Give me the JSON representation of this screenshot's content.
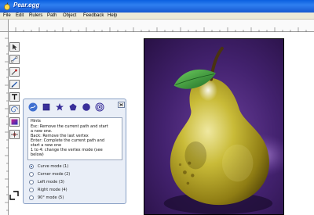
{
  "app": {
    "title": "Pear.egg"
  },
  "menu": {
    "items": [
      "File",
      "Edit",
      "Rulers",
      "Path",
      "Object",
      "Feedback",
      "Help"
    ]
  },
  "toolbar": {
    "tools": [
      {
        "icon": "select-arrow-icon"
      },
      {
        "icon": "node-edit-icon"
      },
      {
        "icon": "eyedropper-icon"
      },
      {
        "icon": "pen-icon"
      },
      {
        "icon": "text-icon"
      },
      {
        "icon": "spiral-icon"
      },
      {
        "icon": "gradient-icon"
      },
      {
        "icon": "crosshair-icon"
      }
    ]
  },
  "shape_palette": {
    "tools": [
      "freehand-path-icon",
      "rectangle-icon",
      "star-icon",
      "polygon-icon",
      "circle-icon",
      "spiral-shape-icon"
    ]
  },
  "help": {
    "title": "Hints",
    "lines": [
      "Esc: Remove the current path and start",
      "a new one.",
      "Back: Remove the last vertex",
      "Enter: Complete the current path and",
      "start a new one",
      "1 to 4: change the vertex mode (see",
      "below)"
    ]
  },
  "modes": [
    {
      "label": "Curve mode (1)",
      "checked": true
    },
    {
      "label": "Corner mode (2)",
      "checked": false
    },
    {
      "label": "Left mode (3)",
      "checked": false
    },
    {
      "label": "Right mode (4)",
      "checked": false
    },
    {
      "label": "90° mode (5)",
      "checked": false
    }
  ],
  "colors": {
    "titlebar": "#1658d0",
    "artboard_bg": "#3d1f6e",
    "pear_body": "#b5a72a",
    "leaf": "#2f8a3a"
  }
}
